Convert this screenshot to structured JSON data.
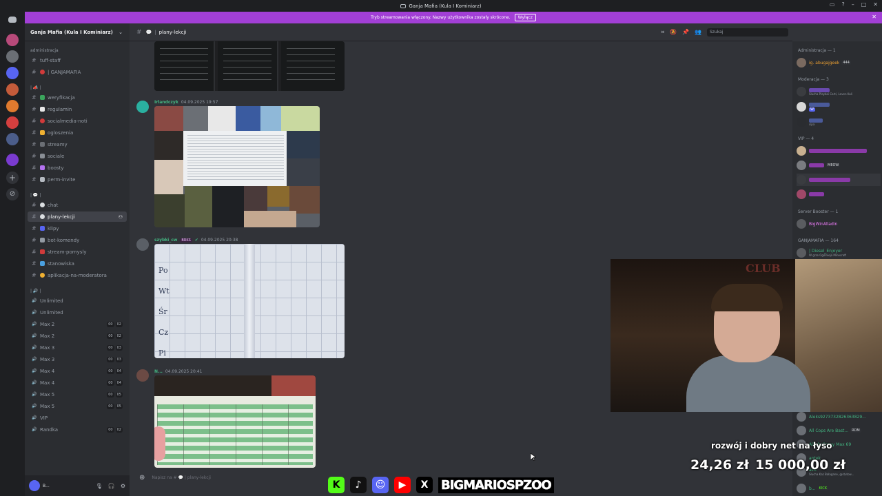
{
  "window": {
    "title": "Ganja Mafia (Kula I Kominiarz)"
  },
  "banner": {
    "text": "Tryb streamowania włączony. Nazwy użytkownika zostały skrócone.",
    "button": "Wyłącz"
  },
  "server": {
    "name": "Ganja Mafia (Kula I Kominiarz)"
  },
  "categories": {
    "admin": "administracja",
    "c2": "| 📣 |",
    "c3": "| 💬 |",
    "c4": "| 🔊 |"
  },
  "channels": [
    "tuff-staff",
    "| GANJAMAFIA",
    "weryfikacja",
    "regulamin",
    "socialmedia-noti",
    "ogloszenia",
    "streamy",
    "sociale",
    "boosty",
    "perm-invite",
    "chat",
    "plany-lekcji",
    "klipy",
    "bot-komendy",
    "stream-pomysly",
    "stanowiska",
    "aplikacja-na-moderatora"
  ],
  "voice": [
    {
      "name": "Unlimited",
      "a": "",
      "b": ""
    },
    {
      "name": "Unlimited",
      "a": "",
      "b": ""
    },
    {
      "name": "Max 2",
      "a": "00",
      "b": "02"
    },
    {
      "name": "Max 2",
      "a": "00",
      "b": "02"
    },
    {
      "name": "Max 3",
      "a": "00",
      "b": "03"
    },
    {
      "name": "Max 3",
      "a": "00",
      "b": "03"
    },
    {
      "name": "Max 4",
      "a": "00",
      "b": "04"
    },
    {
      "name": "Max 4",
      "a": "00",
      "b": "04"
    },
    {
      "name": "Max 5",
      "a": "00",
      "b": "05"
    },
    {
      "name": "Max 5",
      "a": "00",
      "b": "05"
    },
    {
      "name": "VIP",
      "a": "",
      "b": ""
    },
    {
      "name": "Randka",
      "a": "00",
      "b": "02"
    }
  ],
  "header": {
    "channel": "plany-lekcji",
    "search": "Szukaj"
  },
  "messages": [
    {
      "author": "Irlandczyk",
      "time": "04.09.2025 19:57"
    },
    {
      "author": "szybki_cw",
      "tag": "BRKS",
      "time": "04.09.2025 20:38"
    },
    {
      "author": "N...",
      "time": "04.09.2025 20:41"
    }
  ],
  "timetable": {
    "days": [
      "Po",
      "Wt",
      "Śr",
      "Cz",
      "Pi"
    ]
  },
  "composer": {
    "placeholder": "Napisz na # 💬 | plany-lekcji"
  },
  "members": {
    "admin_cat": "Administracja — 1",
    "admin_user": "ig. abugajgeek",
    "admin_badge": "444",
    "mod_cat": "Moderacja — 3",
    "mod_sub": "Słucha Playboi Carti, Leven Kali",
    "mod_badge": "W",
    "mod_status": "cipa",
    "vip_cat": "VIP — 4",
    "vip_badge": "MEOW",
    "booster_cat": "Server Booster — 1",
    "booster_user": "BigWinAlladin",
    "gm_cat": "GANJAMAFIA — 164",
    "gm_user": "| Diesel_Enjoyer",
    "gm_sub": "W grze Ogólnieja Minecraft",
    "bottom": [
      "Aleks9273732826363829...",
      "All Cops Are Bast...",
      "Alkoholiczny Max 69",
      "antek",
      "ave"
    ],
    "bottom_badge1": "RDM",
    "bottom_badge2": "KICK",
    "bottom_sub": "Słucha Kaz Bałagane, @stutow...",
    "last": "b..."
  },
  "overlay": {
    "title": "rozwój i dobry net na łyso",
    "amount": "24,26 zł",
    "goal": "15 000,00 zł"
  },
  "social": {
    "handle": "BIGMARIOSPZOO"
  },
  "user": {
    "name": "B..."
  }
}
